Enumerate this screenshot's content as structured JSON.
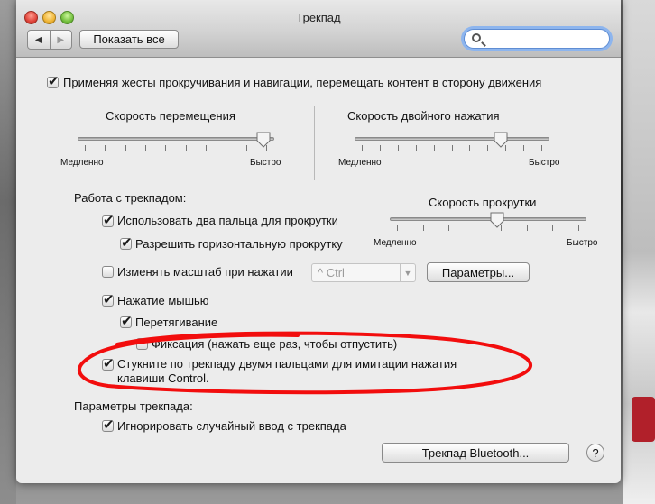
{
  "window": {
    "title": "Трекпад",
    "show_all_label": "Показать все",
    "nav_back_icon": "◀",
    "nav_forward_icon": "▶",
    "search_placeholder": ""
  },
  "natural_scroll": {
    "label": "Применяя жесты прокручивания и навигации, перемещать контент в сторону движения",
    "checked": true
  },
  "tracking_speed": {
    "title": "Скорость перемещения",
    "min_label": "Медленно",
    "max_label": "Быстро",
    "value": 0.98,
    "ticks": 10
  },
  "double_click_speed": {
    "title": "Скорость двойного нажатия",
    "min_label": "Медленно",
    "max_label": "Быстро",
    "value": 0.77,
    "ticks": 11
  },
  "section_trackpad": "Работа с трекпадом:",
  "scroll_speed": {
    "title": "Скорость прокрутки",
    "min_label": "Медленно",
    "max_label": "Быстро",
    "value": 0.55,
    "ticks": 8
  },
  "two_finger_scroll": {
    "label": "Использовать два пальца для прокрутки",
    "checked": true
  },
  "horizontal_scroll": {
    "label": "Разрешить горизонтальную прокрутку",
    "checked": true
  },
  "zoom_on_click": {
    "label": "Изменять масштаб при нажатии",
    "checked": false
  },
  "zoom_modifier": {
    "value": "^ Ctrl",
    "arrow_icon": "▼"
  },
  "params_button": "Параметры...",
  "tap_to_click": {
    "label": "Нажатие мышью",
    "checked": true
  },
  "dragging": {
    "label": "Перетягивание",
    "checked": true
  },
  "drag_lock": {
    "label": "Фиксация (нажать еще раз, чтобы отпустить)",
    "checked": false
  },
  "secondary_click": {
    "label_line1": "Стукните по трекпаду двумя пальцами для имитации нажатия",
    "label_line2": "клавиши Control.",
    "checked": true
  },
  "section_params": "Параметры трекпада:",
  "ignore_accidental": {
    "label": "Игнорировать случайный ввод с трекпада",
    "checked": true
  },
  "bluetooth_button": "Трекпад Bluetooth...",
  "help_button": "?",
  "colors": {
    "scribble": "#f20d0d",
    "search_focus": "#8db5ee"
  }
}
